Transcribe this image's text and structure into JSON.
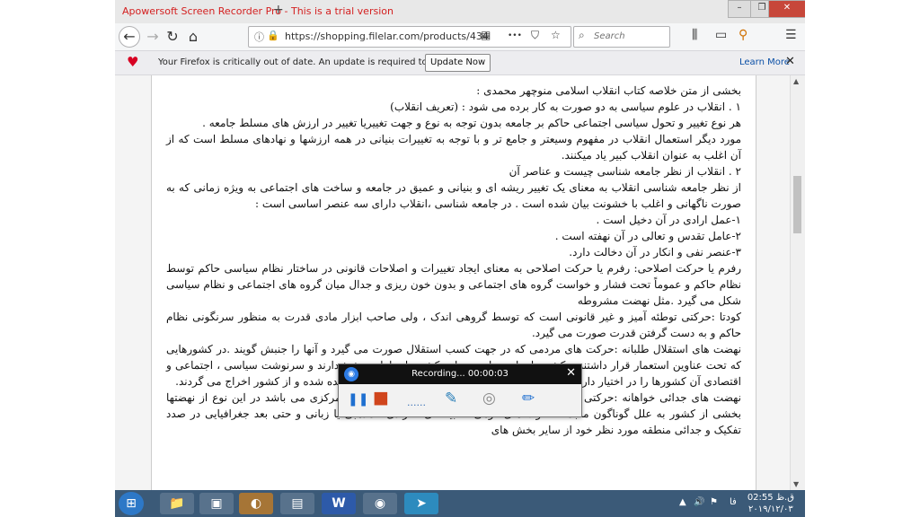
{
  "titlebar": {
    "text": "Apowersoft Screen Recorder Pro - This is a trial version",
    "new_tab": "+"
  },
  "window_controls": {
    "minimize": "–",
    "restore": "❐",
    "close": "✕"
  },
  "toolbar": {
    "back_icon": "←",
    "forward_icon": "→",
    "reload_icon": "↻",
    "home_icon": "⌂",
    "info_icon": "ⓘ",
    "lock_icon": "🔒",
    "url": "https://shopping.filelar.com/products/434",
    "reader_icon": "▤",
    "more_icon": "•••",
    "pocket_icon": "⛉",
    "bookmark_icon": "☆",
    "search_placeholder": "Search",
    "search_icon": "⌕",
    "library_icon": "⫼",
    "sidebar_icon": "▭",
    "ext_icon": "⚲",
    "menu_icon": "☰"
  },
  "notification": {
    "heart_icon": "♥",
    "message": "Your Firefox is critically out of date. An update is required to stay secure.",
    "update_button": "Update Now",
    "learn_more": "Learn More",
    "close_icon": "✕"
  },
  "document": {
    "paragraphs": [
      "بخشی از متن خلاصه کتاب انقلاب اسلامی منوچهر محمدی :",
      "۱ . انقلاب در علوم سیاسی به دو صورت به کار برده می شود : (تعریف انقلاب)",
      "هر نوع تغییر و تحول سیاسی اجتماعی حاکم بر جامعه بدون توجه به نوع و جهت تغییریا تغییر در ارزش های مسلط جامعه .",
      "مورد دیگر استعمال انقلاب در مفهوم وسیعتر و جامع تر و با توجه به تغییرات بنیانی در همه ارزشها و نهادهای مسلط است که از آن اغلب به عنوان انقلاب کبیر یاد میکنند.",
      "۲ . انقلاب از نظر جامعه شناسی چیست و عناصر آن",
      "از نظر جامعه شناسی انقلاب به معنای یک تغییر ریشه ای و بنیانی و عمیق در جامعه و ساخت های اجتماعی به ویژه زمانی که به صورت ناگهانی و اغلب با خشونت بیان شده است . در جامعه شناسی ،انقلاب دارای سه عنصر اساسی است :",
      "۱-عمل ارادی در آن دخیل است .",
      "۲-عامل تقدس و تعالی در آن نهفته است .",
      "۳-عنصر نفی و انکار در آن دخالت دارد.",
      "رفرم یا حرکت اصلاحی: رفرم یا حرکت اصلاحی به معنای ایجاد تغییرات و اصلاحات قانونی در ساختار نظام سیاسی حاکم توسط نظام حاکم و عموماً تحت فشار و خواست گروه های اجتماعی و بدون خون ریزی و جدال میان گروه های اجتماعی و نظام سیاسی شکل می گیرد .مثل نهضت مشروطه",
      "کودتا :حرکتی توطئه آمیز و غیر قانونی است که توسط گروهی اندک ، ولی صاحب ابزار مادی قدرت به منظور سرنگونی نظام حاکم و به دست گرفتن قدرت صورت می گیرد.",
      "نهضت های استقلال طلبانه :حرکت های مردمی که در جهت کسب استقلال صورت می گیرد و آنها را جنبش گویند .در کشورهایی که تحت عناوین استعمار قرار داشتند و کشورهای استعماری در این کشورها سلطه و نفوذ دارند و سرنوشت سیاسی ، اجتماعی و اقتصادی آن کشورها را در اختیار دارند عموماً با قیام های مردمی حاکم بیگانه به چالش کشیده شده و از کشور اخراج می گردند.",
      "نهضت های جدائی خواهانه :حرکتی مردمی در جهت استقلال و جدائی از حاکمیت دولت مرکزی می باشد در این نوع از نهضتها بخشی از کشور به علل گوناگون منجمله تفاوت های قومی ، قبیله ای ، نژادی ، مذهبی یا زبانی و حتی بعد جغرافیایی در صدد تفکیک و جدائی منطقه مورد نظر خود از سایر بخش های"
    ]
  },
  "recorder": {
    "logo_icon": "◉",
    "status": "Recording... 00:00:03",
    "close_icon": "✕",
    "pause_icon": "❚❚",
    "stop_icon": "■",
    "dots": "......",
    "pen_tool_icon": "✎",
    "webcam_icon": "◎",
    "draw_icon": "✏"
  },
  "taskbar": {
    "start_icon": "⊞",
    "apps": [
      "📁",
      "▣",
      "◐",
      "▤",
      "W",
      "◉",
      "➤"
    ],
    "tray": [
      "▲",
      "🔊",
      "⚑"
    ],
    "lang": "فا",
    "time": "02:55 ق.ظ",
    "date": "۲۰۱۹/۱۲/۰۳"
  }
}
